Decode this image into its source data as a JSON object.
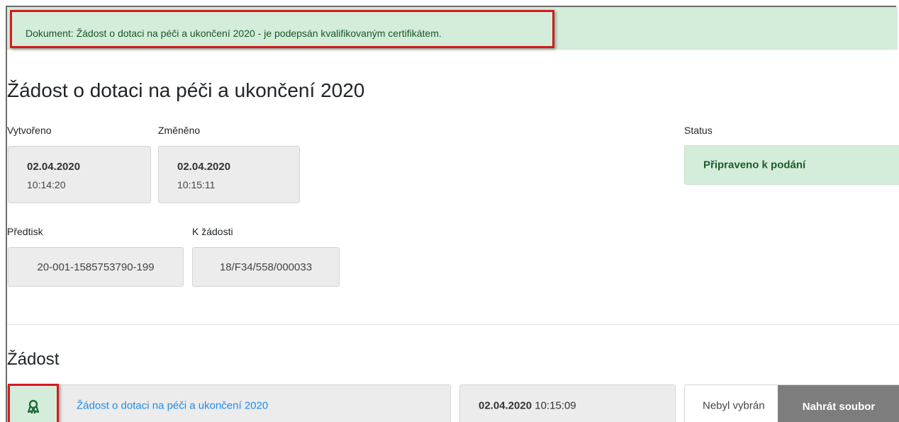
{
  "alert": {
    "message": "Dokument: Žádost o dotaci na péči a ukončení 2020 - je podepsán kvalifikovaným certifikátem."
  },
  "page": {
    "title": "Žádost o dotaci na péči a ukončení 2020"
  },
  "meta": {
    "created_label": "Vytvořeno",
    "created_date": "02.04.2020",
    "created_time": "10:14:20",
    "changed_label": "Změněno",
    "changed_date": "02.04.2020",
    "changed_time": "10:15:11",
    "status_label": "Status",
    "status_value": "Připraveno k podání",
    "pretisk_label": "Předtisk",
    "pretisk_value": "20-001-1585753790-199",
    "k_zadosti_label": "K žádosti",
    "k_zadosti_value": "18/F34/558/000033"
  },
  "section": {
    "title": "Žádost",
    "document_link": "Žádost o dotaci na péči a ukončení 2020",
    "document_date": "02.04.2020",
    "document_time": "10:15:09",
    "file_none_label": "Nebyl vybrán",
    "upload_button": "Nahrát soubor",
    "certificate_icon": "award-icon"
  },
  "colors": {
    "highlight": "#d7191c",
    "success_bg": "#d4edda",
    "success_text": "#155724",
    "link": "#1f8ce6",
    "button_gray": "#7d7d7d"
  }
}
